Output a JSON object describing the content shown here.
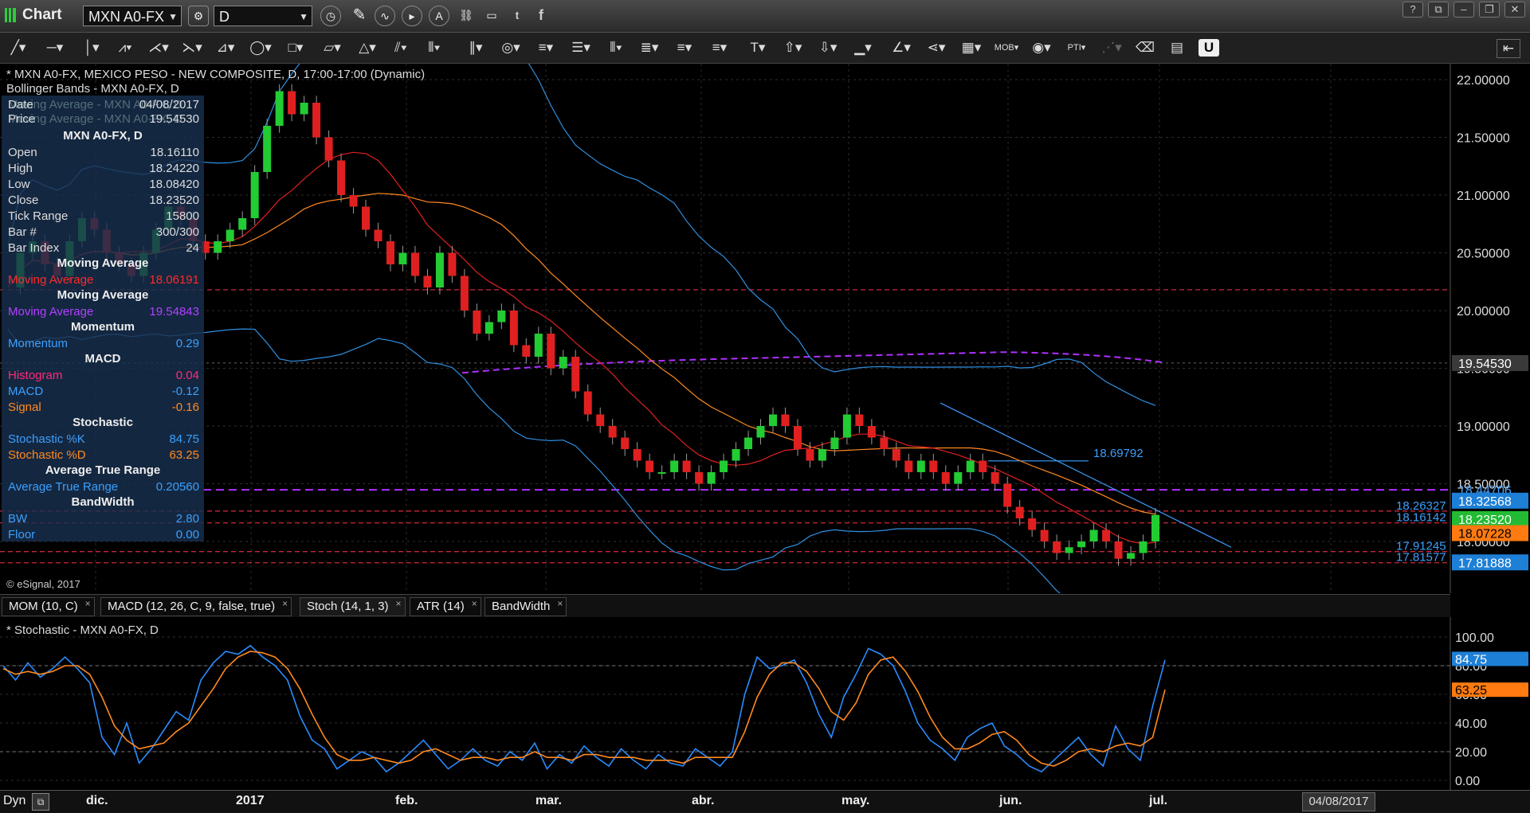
{
  "window": {
    "title": "Chart",
    "symbol": "MXN A0-FX",
    "interval": "D"
  },
  "main_chart": {
    "header_line1": "* MXN A0-FX, MEXICO PESO - NEW COMPOSITE, D, 17:00-17:00 (Dynamic)",
    "header_line2": "Bollinger Bands - MXN A0-FX, D",
    "copyright": "© eSignal, 2017",
    "annotation": "18.69792",
    "price_axis": [
      "22.00000",
      "21.50000",
      "21.00000",
      "20.50000",
      "20.00000",
      "19.50000",
      "19.00000",
      "18.50000",
      "18.00000"
    ],
    "price_labels": [
      {
        "text": "19.54530",
        "bg": "#3a3a3a",
        "color": "#ffffff"
      },
      {
        "text": "18.44706",
        "bg": "transparent",
        "color": "#4aa3ff"
      },
      {
        "text": "18.32568",
        "bg": "#1e7fd6",
        "color": "#ffffff"
      },
      {
        "text": "18.23520",
        "bg": "#22bb33",
        "color": "#ffffff"
      },
      {
        "text": "18.07228",
        "bg": "#ff7a10",
        "color": "#000000"
      },
      {
        "text": "17.81888",
        "bg": "#1e7fd6",
        "color": "#ffffff"
      }
    ],
    "line_labels": [
      "18.26327",
      "18.16142",
      "17.91245",
      "17.81577"
    ],
    "x_axis": [
      "dic.",
      "2017",
      "feb.",
      "mar.",
      "abr.",
      "may.",
      "jun.",
      "jul."
    ],
    "cursor_date": "04/08/2017"
  },
  "data_window": {
    "date_label": "Date",
    "date_value": "04/08/2017",
    "price_label": "Price",
    "price_value": "19.54530",
    "ghost1": "Moving Average - MXN A0-FX, D",
    "ghost2": "Moving Average - MXN A0-FX, D",
    "symbol_title": "MXN A0-FX, D",
    "rows": [
      {
        "label": "Open",
        "value": "18.16110",
        "color": "#dddddd"
      },
      {
        "label": "High",
        "value": "18.24220",
        "color": "#dddddd"
      },
      {
        "label": "Low",
        "value": "18.08420",
        "color": "#dddddd"
      },
      {
        "label": "Close",
        "value": "18.23520",
        "color": "#dddddd"
      },
      {
        "label": "Tick Range",
        "value": "15800",
        "color": "#dddddd"
      },
      {
        "label": "Bar #",
        "value": "300/300",
        "color": "#dddddd"
      },
      {
        "label": "Bar Index",
        "value": "24",
        "color": "#dddddd"
      }
    ],
    "sections": [
      {
        "head": "Moving Average",
        "rows": [
          {
            "label": "Moving Average",
            "value": "18.06191",
            "color": "#ff2a2a"
          }
        ]
      },
      {
        "head": "Moving Average",
        "rows": [
          {
            "label": "Moving Average",
            "value": "19.54843",
            "color": "#b040ff"
          }
        ]
      },
      {
        "head": "Momentum",
        "rows": [
          {
            "label": "Momentum",
            "value": "0.29",
            "color": "#3aa0ff"
          }
        ]
      },
      {
        "head": "MACD",
        "rows": [
          {
            "label": "Histogram",
            "value": "0.04",
            "color": "#ff2a7a"
          },
          {
            "label": "MACD",
            "value": "-0.12",
            "color": "#3aa0ff"
          },
          {
            "label": "Signal",
            "value": "-0.16",
            "color": "#ff8a20"
          }
        ]
      },
      {
        "head": "Stochastic",
        "rows": [
          {
            "label": "Stochastic %K",
            "value": "84.75",
            "color": "#3aa0ff"
          },
          {
            "label": "Stochastic %D",
            "value": "63.25",
            "color": "#ff8a20"
          }
        ]
      },
      {
        "head": "Average True Range",
        "rows": [
          {
            "label": "Average True Range",
            "value": "0.20560",
            "color": "#3aa0ff"
          }
        ]
      },
      {
        "head": "BandWidth",
        "rows": [
          {
            "label": "BW",
            "value": "2.80",
            "color": "#3aa0ff"
          },
          {
            "label": "Floor",
            "value": "0.00",
            "color": "#3aa0ff"
          }
        ]
      }
    ]
  },
  "study_tabs": [
    "MOM (10, C)",
    "MACD (12, 26, C, 9, false, true)",
    "Stoch (14, 1, 3)",
    "ATR (14)",
    "BandWidth"
  ],
  "stoch_panel": {
    "header": "* Stochastic - MXN A0-FX, D",
    "axis": [
      "100.00",
      "80.00",
      "60.00",
      "40.00",
      "20.00",
      "0.00"
    ],
    "k_label": "84.75",
    "d_label": "63.25"
  },
  "bottom": {
    "dyn_label": "Dyn"
  },
  "chart_data": [
    {
      "type": "candlestick",
      "title": "MXN A0-FX, MEXICO PESO - NEW COMPOSITE, D",
      "x": [
        "dic.",
        "2017",
        "feb.",
        "mar.",
        "abr.",
        "may.",
        "jun.",
        "jul."
      ],
      "ylim": [
        17.6,
        22.1
      ],
      "close_series": [
        20.2,
        20.5,
        20.6,
        20.4,
        20.3,
        20.6,
        20.8,
        20.7,
        20.5,
        20.4,
        20.3,
        20.5,
        20.7,
        20.9,
        20.8,
        20.6,
        20.5,
        20.6,
        20.7,
        20.8,
        21.2,
        21.6,
        21.9,
        21.7,
        21.8,
        21.5,
        21.3,
        21.0,
        20.9,
        20.7,
        20.6,
        20.4,
        20.5,
        20.3,
        20.2,
        20.5,
        20.3,
        20.0,
        19.8,
        19.9,
        20.0,
        19.7,
        19.6,
        19.8,
        19.5,
        19.6,
        19.3,
        19.1,
        19.0,
        18.9,
        18.8,
        18.7,
        18.6,
        18.6,
        18.7,
        18.6,
        18.5,
        18.6,
        18.7,
        18.8,
        18.9,
        19.0,
        19.1,
        19.0,
        18.8,
        18.7,
        18.8,
        18.9,
        19.1,
        19.0,
        18.9,
        18.8,
        18.7,
        18.6,
        18.7,
        18.6,
        18.5,
        18.6,
        18.7,
        18.6,
        18.5,
        18.3,
        18.2,
        18.1,
        18.0,
        17.9,
        17.95,
        18.0,
        18.1,
        18.0,
        17.85,
        17.9,
        18.0,
        18.23
      ],
      "bands": {
        "upper_start": 22.8,
        "middle": "20-period",
        "lower_start": 19.9
      },
      "horizontal_lines": [
        20.18,
        19.5453,
        18.44706,
        18.26327,
        18.16142,
        17.91245,
        17.81577
      ],
      "moving_average_long": 19.54843,
      "last": {
        "close": 18.2352,
        "ma_short": 18.07228,
        "bb_upper": 18.32568,
        "bb_lower": 17.81888
      }
    },
    {
      "type": "line",
      "title": "Stochastic - MXN A0-FX, D",
      "ylim": [
        0,
        100
      ],
      "series": [
        {
          "name": "Stochastic %K",
          "color": "#2a8cff",
          "values": [
            80,
            70,
            82,
            72,
            78,
            86,
            78,
            68,
            30,
            18,
            40,
            12,
            22,
            35,
            48,
            42,
            70,
            82,
            90,
            88,
            94,
            86,
            80,
            70,
            45,
            28,
            22,
            8,
            14,
            20,
            16,
            6,
            12,
            20,
            28,
            18,
            8,
            14,
            22,
            14,
            10,
            20,
            14,
            26,
            8,
            18,
            12,
            24,
            16,
            10,
            22,
            14,
            8,
            18,
            12,
            10,
            22,
            16,
            10,
            20,
            60,
            86,
            78,
            80,
            84,
            68,
            46,
            30,
            58,
            74,
            92,
            88,
            80,
            62,
            40,
            28,
            22,
            14,
            30,
            36,
            40,
            24,
            18,
            10,
            6,
            14,
            22,
            30,
            18,
            10,
            38,
            22,
            14,
            52,
            84
          ]
        },
        {
          "name": "Stochastic %D",
          "color": "#ff8a20",
          "values": [
            78,
            74,
            76,
            74,
            76,
            80,
            80,
            74,
            58,
            38,
            28,
            22,
            24,
            26,
            34,
            40,
            52,
            64,
            78,
            86,
            90,
            89,
            86,
            78,
            64,
            46,
            30,
            18,
            14,
            14,
            16,
            14,
            12,
            14,
            20,
            22,
            18,
            14,
            16,
            16,
            14,
            16,
            16,
            20,
            16,
            16,
            14,
            18,
            18,
            16,
            16,
            16,
            14,
            14,
            14,
            12,
            16,
            16,
            16,
            16,
            34,
            58,
            74,
            82,
            82,
            76,
            64,
            48,
            42,
            54,
            74,
            84,
            86,
            76,
            62,
            44,
            30,
            22,
            22,
            26,
            32,
            34,
            28,
            18,
            12,
            10,
            14,
            20,
            22,
            20,
            24,
            26,
            24,
            30,
            63.25
          ]
        }
      ]
    }
  ]
}
